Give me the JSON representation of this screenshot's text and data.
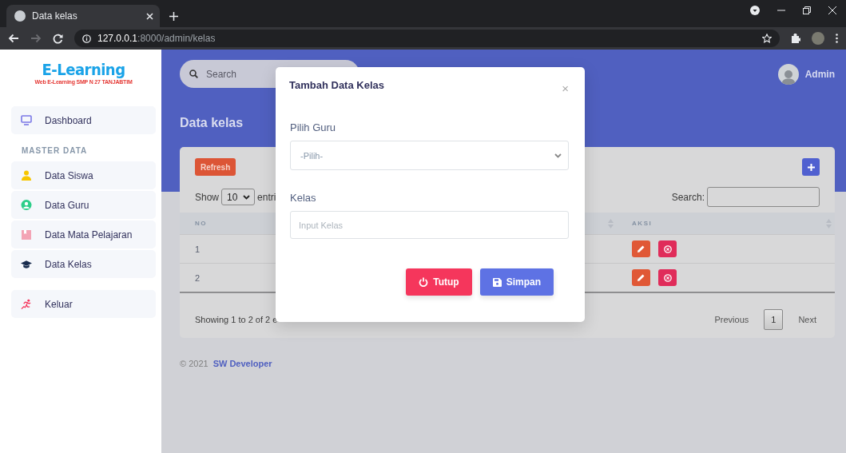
{
  "browser": {
    "tab": {
      "title": "Data kelas"
    },
    "nav": [
      {
        "kind": "back",
        "disabled": false
      },
      {
        "kind": "forward",
        "disabled": true
      },
      {
        "kind": "reload",
        "disabled": false
      }
    ],
    "url": {
      "host": "127.0.0.1",
      "path": ":8000/admin/kelas"
    }
  },
  "sidebar": {
    "logo": {
      "title": "E-Learning",
      "subtitle": "Web E-Learning SMP N 27 TANJABTIM"
    },
    "items": [
      {
        "kind": "monitor",
        "label": "Dashboard"
      },
      {
        "kind": "heading",
        "label": "MASTER DATA"
      },
      {
        "kind": "person",
        "label": "Data Siswa"
      },
      {
        "kind": "user-circle",
        "label": "Data Guru"
      },
      {
        "kind": "book",
        "label": "Data Mata Pelajaran"
      },
      {
        "kind": "cap",
        "label": "Data Kelas"
      },
      {
        "kind": "gap"
      },
      {
        "kind": "runner",
        "label": "Keluar"
      }
    ]
  },
  "topbar": {
    "search": {
      "placeholder": "Search"
    },
    "user": "Admin"
  },
  "page_title": "Data kelas",
  "card": {
    "refresh": "Refresh",
    "show_label": "Show",
    "entries_value": "10",
    "entries_label": "entri",
    "search_label": "Search:",
    "table": {
      "columns": [
        {
          "label": "NO",
          "sortable": false
        },
        {
          "sortable": true
        },
        {
          "label": "AKSI",
          "sortable": true
        }
      ],
      "rows": [
        {
          "no": "1"
        },
        {
          "no": "2"
        }
      ]
    },
    "info": "Showing 1 to 2 of 2 e",
    "pagination": [
      {
        "label": "Previous",
        "selected": false
      },
      {
        "label": "1",
        "selected": true
      },
      {
        "label": "Next",
        "selected": false
      }
    ]
  },
  "footer": {
    "copyright": "© 2021",
    "author": "SW Developer"
  },
  "modal": {
    "title": "Tambah Data Kelas",
    "close": "×",
    "fields": [
      {
        "kind": "select",
        "label": "Pilih Guru",
        "value": "-Pilih-"
      },
      {
        "kind": "input",
        "label": "Kelas",
        "placeholder": "Input Kelas"
      }
    ],
    "buttons": [
      {
        "kind": "close",
        "label": "Tutup"
      },
      {
        "kind": "save",
        "label": "Simpan"
      }
    ]
  }
}
